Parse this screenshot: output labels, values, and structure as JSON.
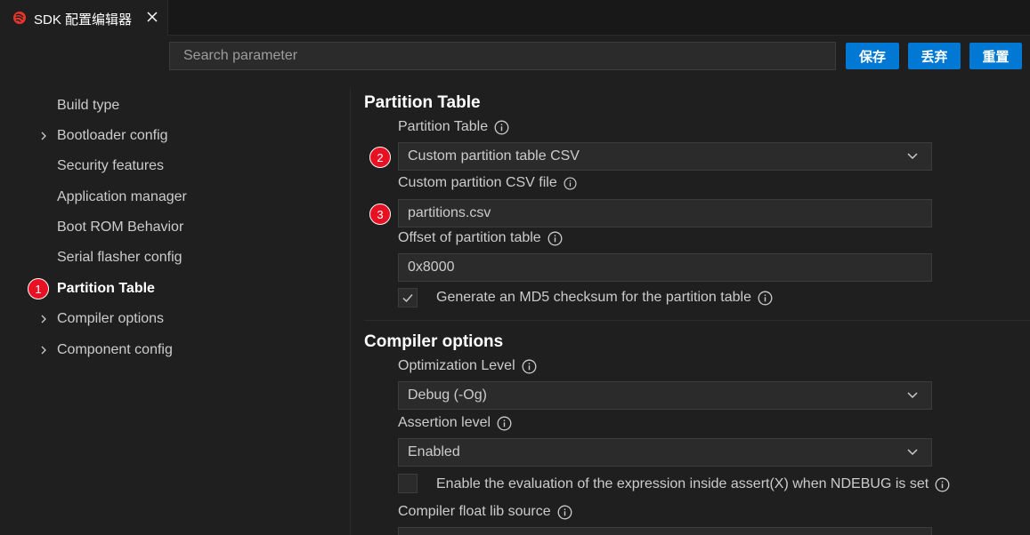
{
  "tab": {
    "title": "SDK 配置编辑器"
  },
  "toolbar": {
    "search_placeholder": "Search parameter",
    "save_label": "保存",
    "discard_label": "丢弃",
    "reset_label": "重置"
  },
  "sidebar": {
    "items": [
      {
        "label": "Build type",
        "expandable": false
      },
      {
        "label": "Bootloader config",
        "expandable": true
      },
      {
        "label": "Security features",
        "expandable": false
      },
      {
        "label": "Application manager",
        "expandable": false
      },
      {
        "label": "Boot ROM Behavior",
        "expandable": false
      },
      {
        "label": "Serial flasher config",
        "expandable": false
      },
      {
        "label": "Partition Table",
        "expandable": false,
        "active": true
      },
      {
        "label": "Compiler options",
        "expandable": true
      },
      {
        "label": "Component config",
        "expandable": true
      }
    ]
  },
  "badges": {
    "b1": "1",
    "b2": "2",
    "b3": "3"
  },
  "partition": {
    "title": "Partition Table",
    "table_label": "Partition Table",
    "table_value": "Custom partition table CSV",
    "csv_label": "Custom partition CSV file",
    "csv_value": "partitions.csv",
    "offset_label": "Offset of partition table",
    "offset_value": "0x8000",
    "md5_label": "Generate an MD5 checksum for the partition table",
    "md5_checked": true
  },
  "compiler": {
    "title": "Compiler options",
    "opt_label": "Optimization Level",
    "opt_value": "Debug (-Og)",
    "assert_label": "Assertion level",
    "assert_value": "Enabled",
    "ndebug_label": "Enable the evaluation of the expression inside assert(X) when NDEBUG is set",
    "ndebug_checked": false,
    "float_label": "Compiler float lib source"
  },
  "colors": {
    "accent": "#0078d4",
    "badge": "#e81123",
    "background": "#1f1f1f",
    "input_bg": "#2b2b2b"
  }
}
